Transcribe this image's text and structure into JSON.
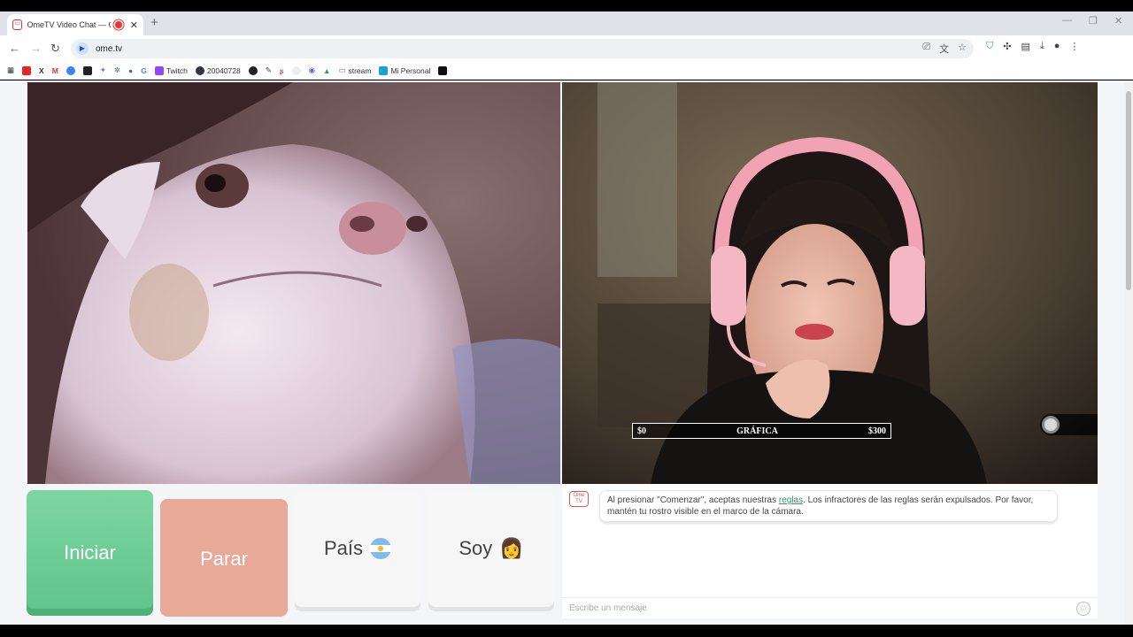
{
  "browser": {
    "tab_title": "OmeTV Video Chat — Ome",
    "url": "ome.tv",
    "bookmarks": [
      "Twitch",
      "20040728",
      "stream",
      "Mi Personal"
    ]
  },
  "video": {
    "graph_bar": {
      "left": "$0",
      "center": "GRÁFICA",
      "right": "$300"
    }
  },
  "controls": {
    "start_label": "Iniciar",
    "stop_label": "Parar",
    "country_label": "País",
    "soy_label": "Soy",
    "soy_emoji": "👩"
  },
  "chat": {
    "logo_text": "Ome TV",
    "msg_before": "Al presionar \"Comenzar\", aceptas nuestras ",
    "msg_link": "reglas",
    "msg_after": ". Los infractores de las reglas serán expulsados. Por favor, mantén tu rostro visible en el marco de la cámara.",
    "input_placeholder": "Escribe un mensaje"
  }
}
